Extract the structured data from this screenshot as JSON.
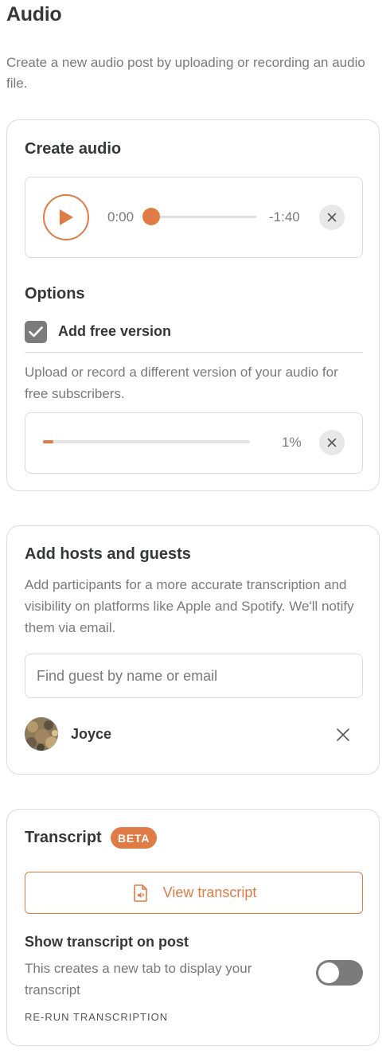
{
  "page": {
    "title": "Audio",
    "description": "Create a new audio post by uploading or recording an audio file."
  },
  "create_audio": {
    "title": "Create audio",
    "player": {
      "current_time": "0:00",
      "remaining_time": "-1:40",
      "progress": 0
    },
    "options": {
      "title": "Options",
      "free_version_label": "Add free version",
      "free_version_checked": true,
      "help": "Upload or record a different version of your audio for free subscribers.",
      "upload_percent_text": "1%",
      "upload_percent": 1
    }
  },
  "hosts": {
    "title": "Add hosts and guests",
    "description": "Add participants for a more accurate transcription and visibility on platforms like Apple and Spotify. We'll notify them via email.",
    "search_placeholder": "Find guest by name or email",
    "guests": [
      {
        "name": "Joyce"
      }
    ]
  },
  "transcript": {
    "title": "Transcript",
    "badge": "BETA",
    "view_button": "View transcript",
    "show_title": "Show transcript on post",
    "show_help": "This creates a new tab to display your transcript",
    "show_enabled": false,
    "rerun_label": "RE-RUN TRANSCRIPTION"
  },
  "colors": {
    "accent": "#e07b46",
    "text": "#363737",
    "muted": "#7a7a7a",
    "border": "#dcdcdc"
  },
  "icons": {
    "play": "play-icon",
    "close": "close-icon",
    "check": "check-icon",
    "transcript": "transcript-file-icon"
  }
}
